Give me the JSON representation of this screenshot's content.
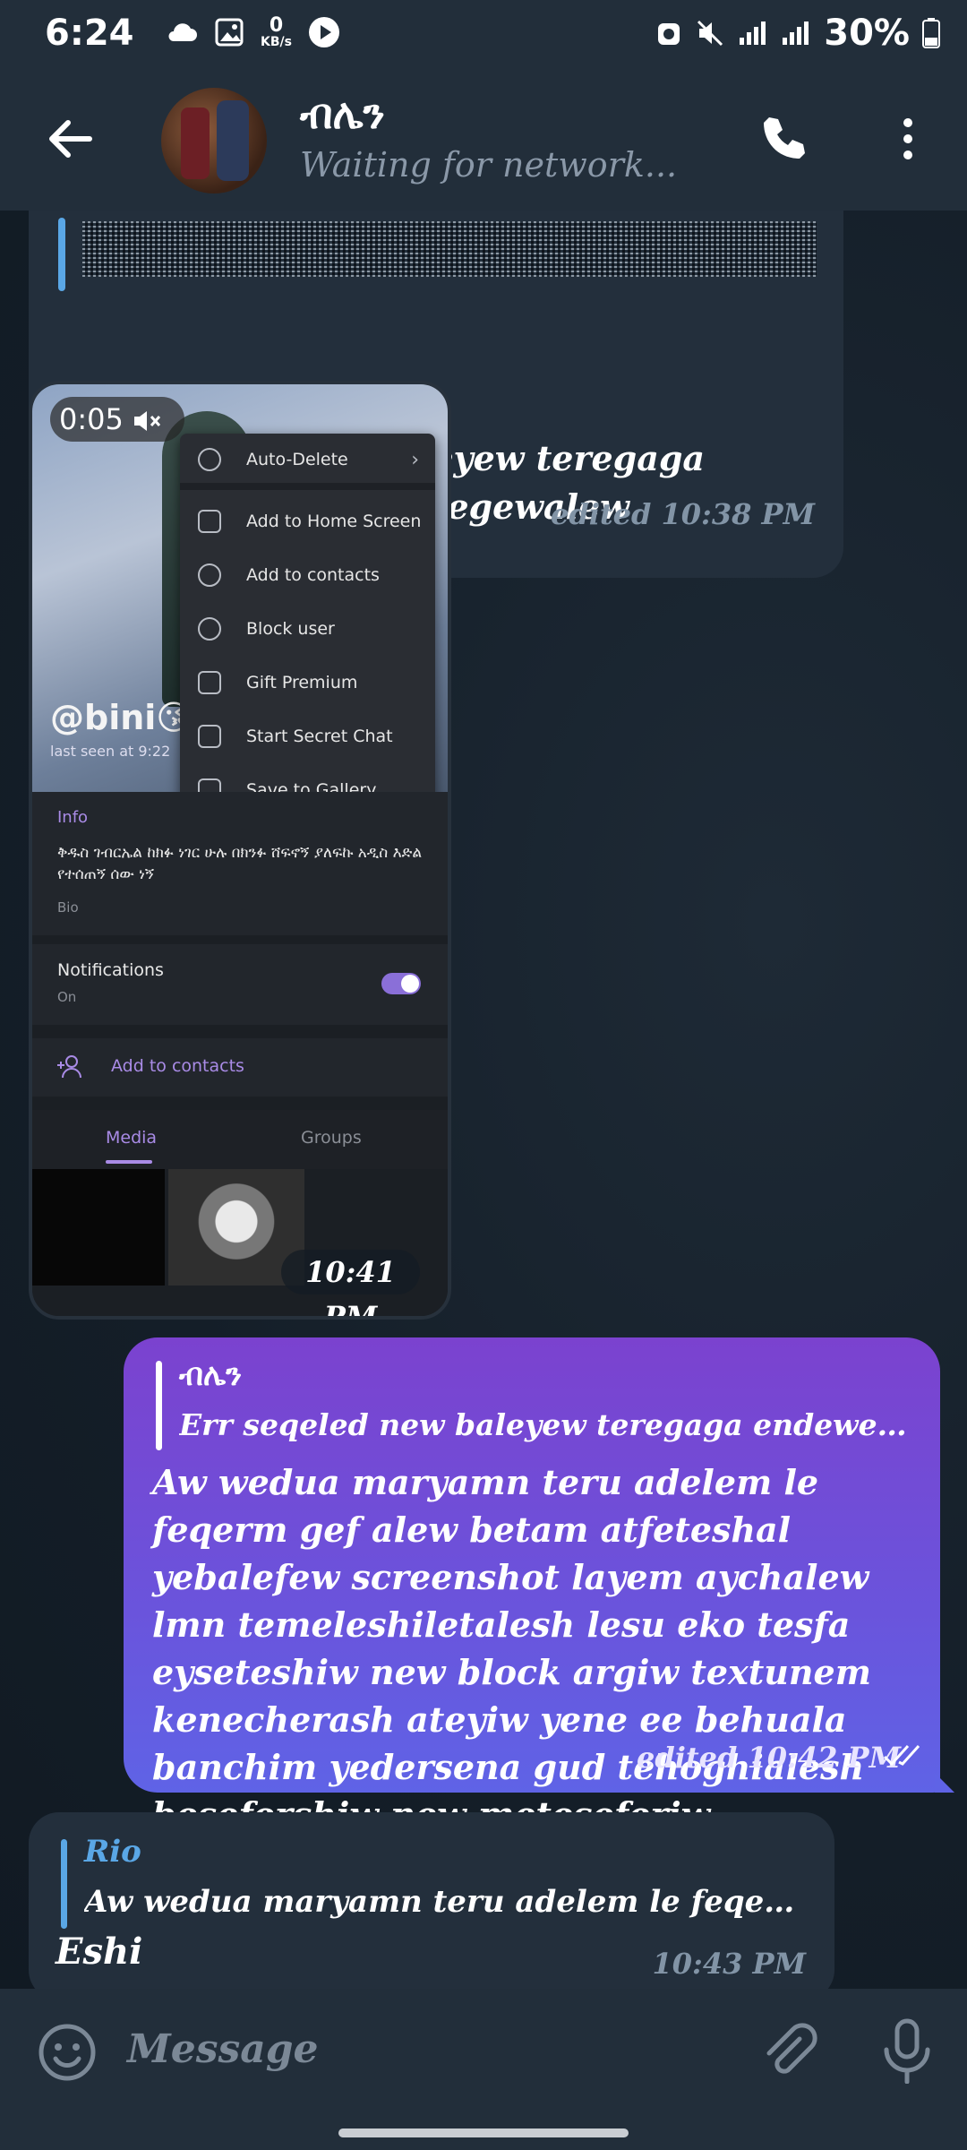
{
  "status_bar": {
    "time": "6:24",
    "net_speed_value": "0",
    "net_speed_unit": "KB/s",
    "battery": "30%"
  },
  "header": {
    "name": "ብሌን",
    "status": "Waiting for network..."
  },
  "messages": {
    "m1": {
      "text": "Err seqeled new baleyew teregaga endewem block aderegewalew",
      "meta": "edited 10:38 PM"
    },
    "m2": {
      "duration": "0:05",
      "timestamp": "10:41 PM",
      "shot": {
        "handle": "@bini😘",
        "last_seen": "last seen at 9:22",
        "menu": [
          "Auto-Delete",
          "Add to Home Screen",
          "Add to contacts",
          "Block user",
          "Gift Premium",
          "Start Secret Chat",
          "Save to Gallery"
        ],
        "info_header": "Info",
        "bio_text": "ቅዱስ ገብርኤል ከክፉ ነገር ሁሉ በክንፉ ሸፍኖኝ ያለፍኩ አዲስ እድል የተሰጠኝ ሰው ነኝ",
        "bio_label": "Bio",
        "notifications": "Notifications",
        "notifications_state": "On",
        "add_contacts": "Add to contacts",
        "tab_media": "Media",
        "tab_groups": "Groups"
      }
    },
    "m3": {
      "reply_name": "ብሌን",
      "reply_text": "Err seqeled new baleyew teregaga endewem block adere...",
      "text": "Aw wedua maryamn teru adelem le feqerm gef alew betam atfeteshal yebalefew screenshot layem aychalew lmn temeleshiletalesh lesu eko tesfa eyseteshiw new block argiw textunem kenecherash ateyiw yene ee behuala banchim yedersena gud tehoghialesh besefershiw new meteseferiw",
      "meta": "edited 10:42 PM"
    },
    "m4": {
      "reply_name": "Rio",
      "reply_text": "Aw wedua maryamn teru adelem le feqerm gef alew b...",
      "text": "Eshi",
      "meta": "10:43 PM"
    }
  },
  "input": {
    "placeholder": "Message"
  },
  "colors": {
    "accent": "#6a54dc",
    "link": "#5aa7e6",
    "bg": "#17212b"
  }
}
